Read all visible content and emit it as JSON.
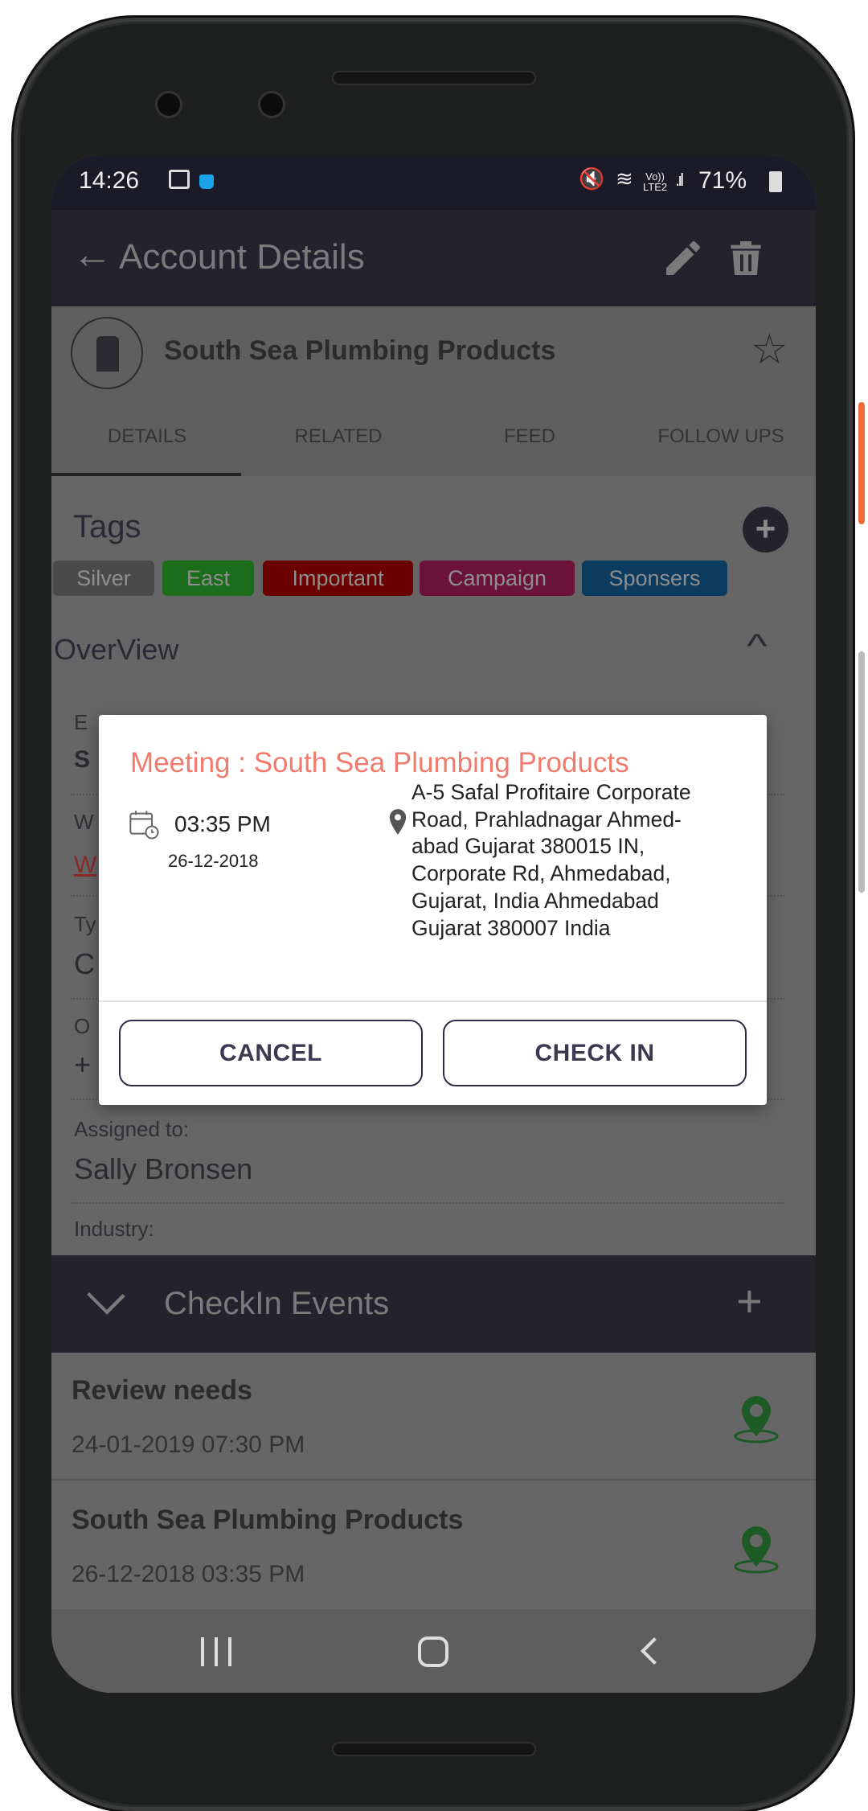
{
  "status_bar": {
    "time": "14:26",
    "battery": "71%",
    "network": "LTE2"
  },
  "app_bar": {
    "title": "Account Details",
    "back_icon": "arrow-left-icon",
    "edit_icon": "pencil-icon",
    "delete_icon": "trash-icon"
  },
  "account": {
    "name": "South Sea Plumbing Products",
    "avatar_icon": "cabinet-icon",
    "favorite_icon": "star-outline-icon"
  },
  "tabs": [
    {
      "label": "DETAILS",
      "active": true
    },
    {
      "label": "RELATED"
    },
    {
      "label": "FEED"
    },
    {
      "label": "FOLLOW UPS"
    }
  ],
  "tags": {
    "title": "Tags",
    "items": [
      {
        "label": "Silver",
        "color": "#4a4a4a"
      },
      {
        "label": "East",
        "color": "#1b6d1b"
      },
      {
        "label": "Important",
        "color": "#6a0000"
      },
      {
        "label": "Campaign",
        "color": "#6b1238"
      },
      {
        "label": "Sponsers",
        "color": "#0b3b5e"
      }
    ]
  },
  "overview": {
    "title": "OverView",
    "fields_partial": [
      {
        "label": "E",
        "value": "S"
      },
      {
        "label": "W",
        "value": "W"
      },
      {
        "label": "Ty",
        "value": "C"
      },
      {
        "label": "O",
        "value": "+"
      }
    ],
    "assigned_label": "Assigned to:",
    "assigned_value": "Sally Bronsen",
    "industry_label": "Industry:"
  },
  "checkin": {
    "title": "CheckIn Events",
    "items": [
      {
        "title": "Review needs",
        "datetime": "24-01-2019 07:30 PM"
      },
      {
        "title": "South Sea Plumbing Products",
        "datetime": "26-12-2018 03:35 PM"
      }
    ]
  },
  "dialog": {
    "title": "Meeting : South Sea Plumbing Products",
    "time": "03:35 PM",
    "date": "26-12-2018",
    "address_lines": [
      "A-5 Safal Profitaire Corporate",
      "Road, Prahladnagar Ahmed-",
      "abad Gujarat 380015 IN,",
      "Corporate Rd, Ahmedabad,",
      "Gujarat, India Ahmedabad",
      "Gujarat 380007 India"
    ],
    "cancel_label": "CANCEL",
    "checkin_label": "CHECK IN",
    "title_color": "#f07b6d"
  }
}
